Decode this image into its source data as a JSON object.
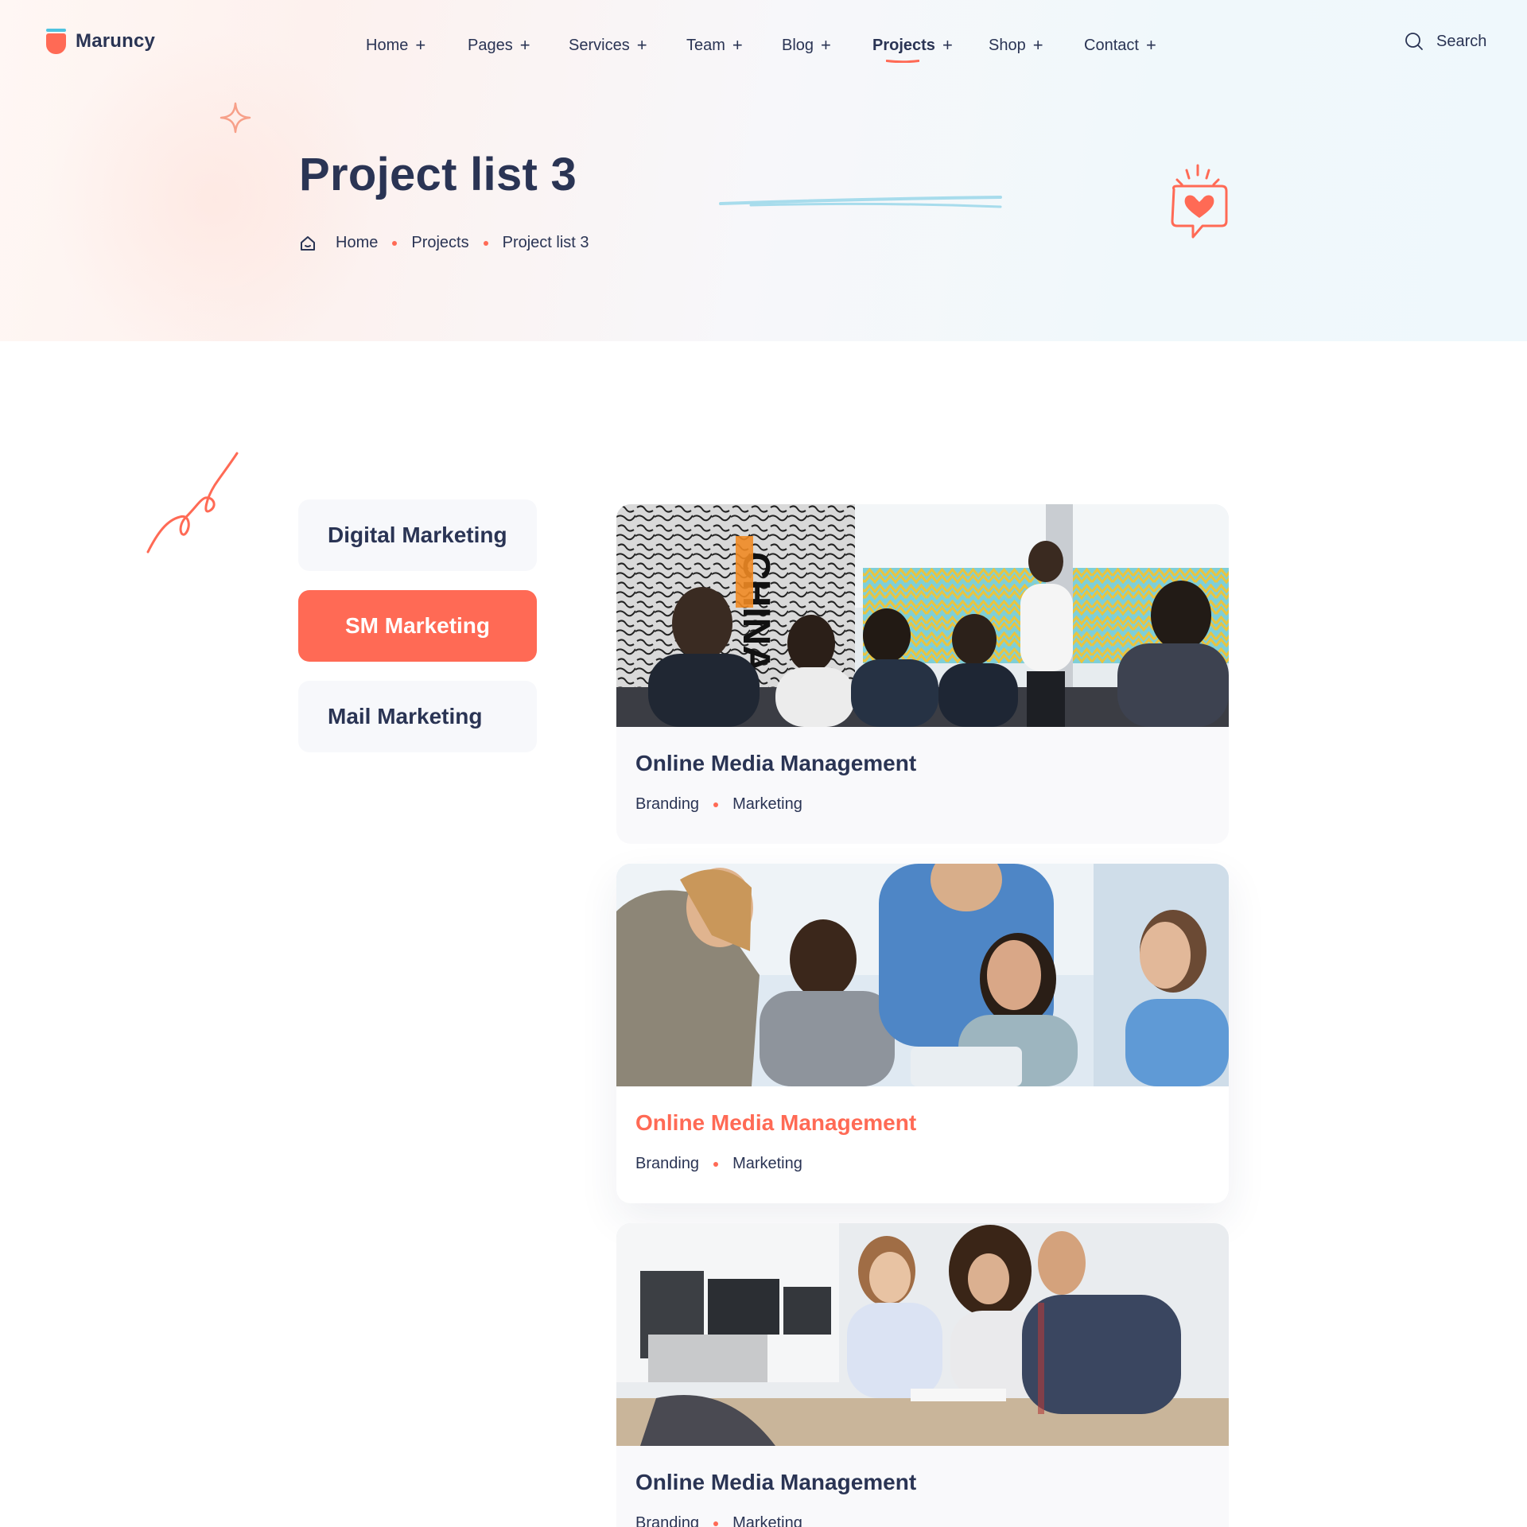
{
  "brand": {
    "name": "Maruncy"
  },
  "nav": {
    "items": [
      {
        "label": "Home",
        "active": false
      },
      {
        "label": "Pages",
        "active": false
      },
      {
        "label": "Services",
        "active": false
      },
      {
        "label": "Team",
        "active": false
      },
      {
        "label": "Blog",
        "active": false
      },
      {
        "label": "Projects",
        "active": true
      },
      {
        "label": "Shop",
        "active": false
      },
      {
        "label": "Contact",
        "active": false
      }
    ],
    "expand_symbol": "+",
    "search_label": "Search"
  },
  "hero": {
    "title": "Project list 3",
    "breadcrumb": [
      "Home",
      "Projects",
      "Project list 3"
    ]
  },
  "categories": [
    {
      "label": "Digital Marketing",
      "active": false
    },
    {
      "label": "SM Marketing",
      "active": true
    },
    {
      "label": "Mail Marketing",
      "active": false
    }
  ],
  "projects": [
    {
      "title": "Online Media Management",
      "tags": [
        "Branding",
        "Marketing"
      ],
      "image": "team meeting in office with presenter",
      "hovered": false
    },
    {
      "title": "Online Media Management",
      "tags": [
        "Branding",
        "Marketing"
      ],
      "image": "colleagues smiling around laptop",
      "hovered": true
    },
    {
      "title": "Online Media Management",
      "tags": [
        "Branding",
        "Marketing"
      ],
      "image": "team reviewing papers at desk",
      "hovered": false
    }
  ],
  "colors": {
    "accent": "#ff6a55",
    "text": "#2a3454",
    "logo_rim": "#4fc3e0",
    "card_bg": "#f9f9fb",
    "button_bg": "#f7f8fb"
  },
  "icons": [
    "logo-icon",
    "search-icon",
    "home-icon",
    "sparkle-icon",
    "chat-heart-icon"
  ]
}
